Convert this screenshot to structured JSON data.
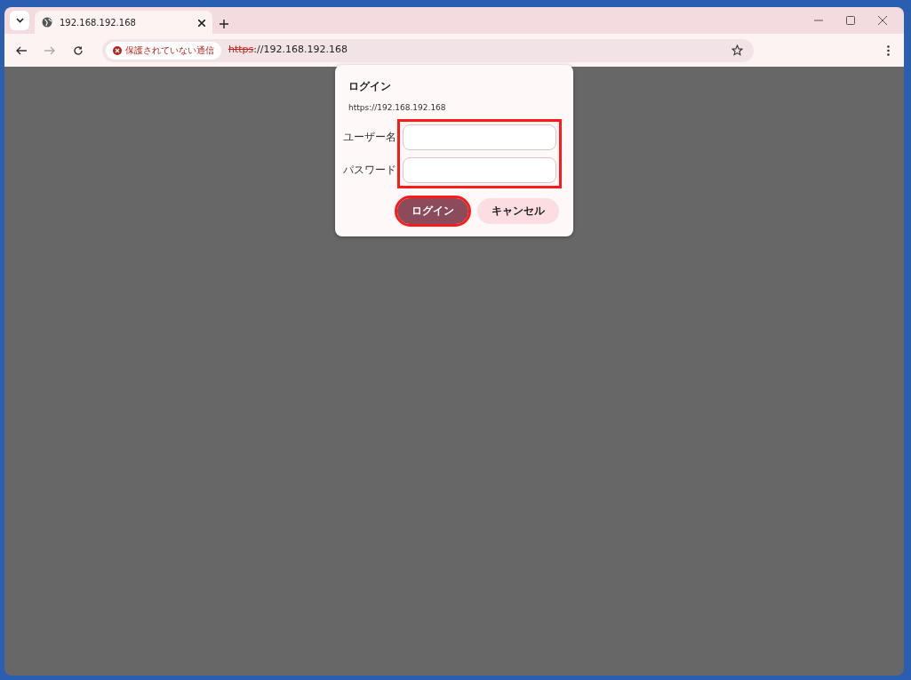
{
  "tab": {
    "title": "192.168.192.168",
    "selected": true
  },
  "address_bar": {
    "security_label": "保護されていない通信",
    "scheme": "https",
    "rest": "://192.168.192.168"
  },
  "dialog": {
    "title": "ログイン",
    "origin": "https://192.168.192.168",
    "fields": [
      {
        "label": "ユーザー名"
      },
      {
        "label": "パスワード"
      }
    ],
    "fields_highlighted": true,
    "buttons": [
      {
        "label": "ログイン",
        "kind": "primary",
        "highlighted": true
      },
      {
        "label": "キャンセル",
        "kind": "secondary",
        "highlighted": false
      }
    ]
  }
}
